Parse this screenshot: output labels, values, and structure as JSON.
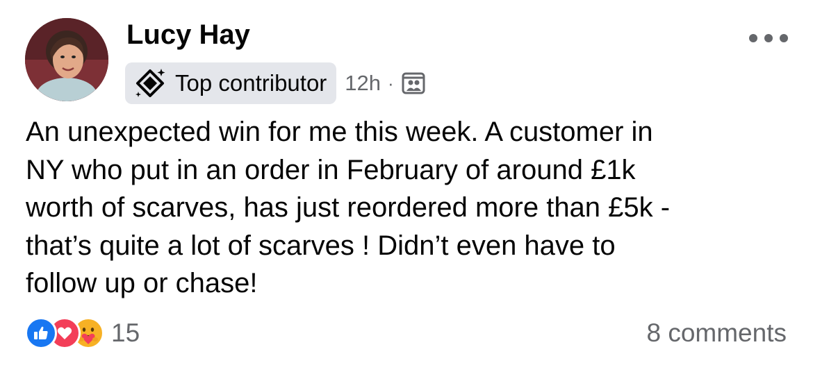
{
  "post": {
    "author": {
      "name": "Lucy Hay",
      "avatar_icon": "profile-photo"
    },
    "badge": {
      "label": "Top contributor",
      "icon": "diamond-sparkle-icon"
    },
    "time": "12h",
    "separator": "·",
    "audience_icon": "group-audience-icon",
    "more_icon": "more-horizontal-icon",
    "text_lines": [
      "An unexpected win for me this week.  A customer in",
      "NY who put in an order in February of around £1k",
      "worth of scarves, has just reordered more than £5k -",
      "that’s quite a lot of scarves !  Didn’t even have to",
      "follow up or chase!"
    ],
    "reactions": {
      "icons": [
        "like-icon",
        "love-icon",
        "care-icon"
      ],
      "count": "15"
    },
    "comments": "8 comments"
  },
  "colors": {
    "text_primary": "#050505",
    "text_secondary": "#65676b",
    "badge_bg": "#e4e6eb",
    "like_blue": "#1877f2",
    "love_red": "#f33e58",
    "care_yellow": "#f7b125"
  }
}
